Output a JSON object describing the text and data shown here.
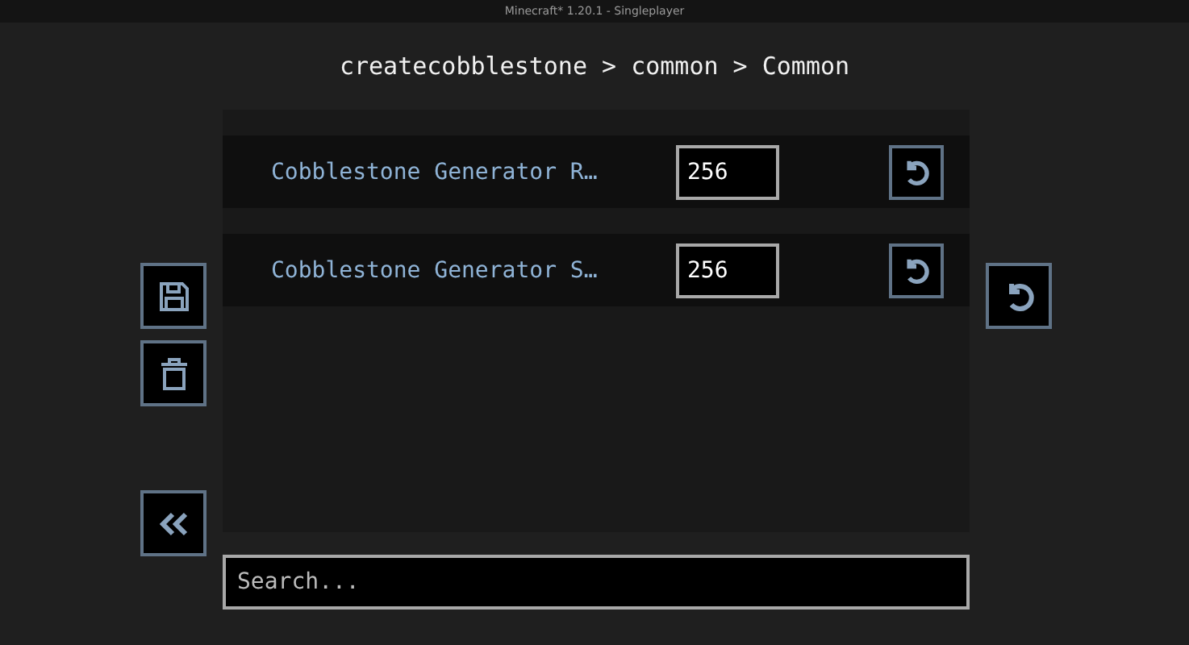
{
  "window": {
    "title": "Minecraft* 1.20.1 - Singleplayer"
  },
  "breadcrumb": "createcobblestone > common > Common",
  "entries": [
    {
      "label": "Cobblestone Generator R…",
      "value": "256"
    },
    {
      "label": "Cobblestone Generator S…",
      "value": "256"
    }
  ],
  "search": {
    "placeholder": "Search..."
  }
}
